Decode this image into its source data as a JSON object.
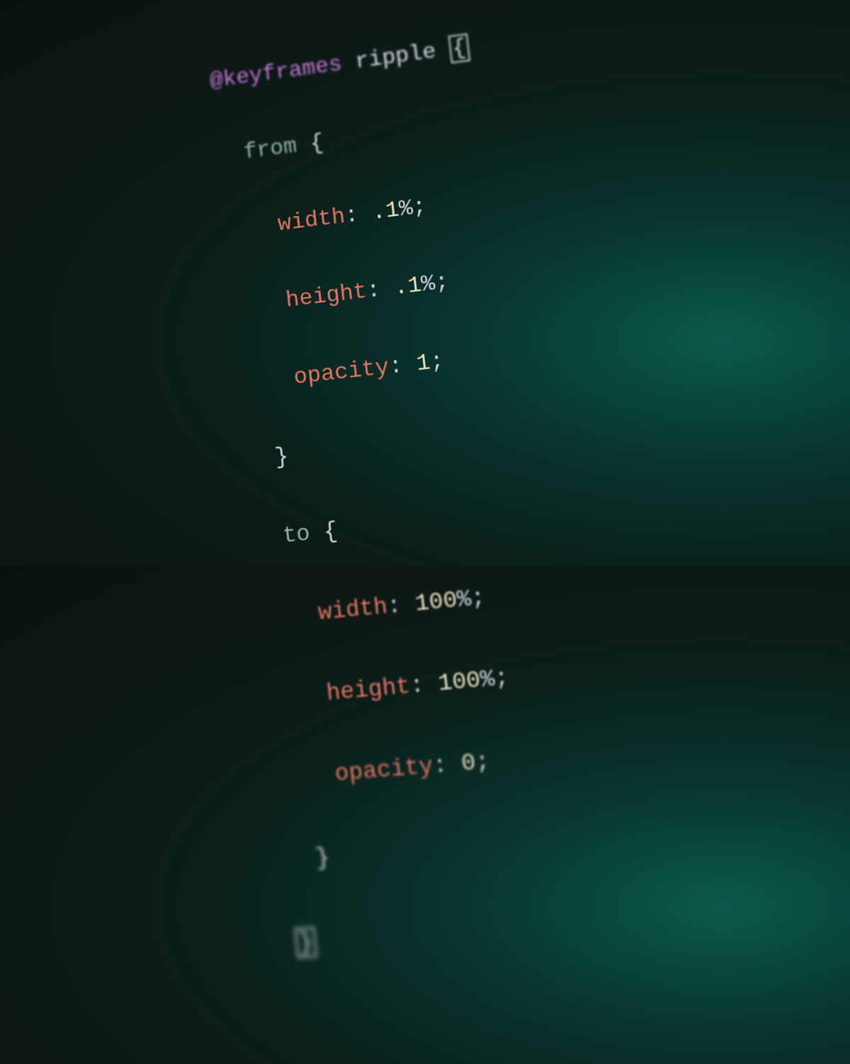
{
  "colors": {
    "at_rule": "#c47ad6",
    "keyword": "#8fb5ab",
    "property": "#e47a66",
    "number": "#f2e6c2",
    "punctuation": "#cfd6db",
    "identifier": "#d8dee6"
  },
  "code": {
    "at": "@",
    "rule": "keyframes",
    "name": "ripple",
    "open": "{",
    "close": "}",
    "from_kw": "from",
    "to_kw": "to",
    "props": {
      "width": "width",
      "height": "height",
      "opacity": "opacity"
    },
    "colon": ":",
    "semi": ";",
    "pct": "%",
    "from_vals": {
      "width": ".1",
      "height": ".1",
      "opacity": "1"
    },
    "to_vals": {
      "width": "100",
      "height": "100",
      "opacity": "0"
    }
  },
  "gutter": {
    "a": "",
    "b": "",
    "c": "",
    "d": "",
    "e": "",
    "f": ""
  }
}
